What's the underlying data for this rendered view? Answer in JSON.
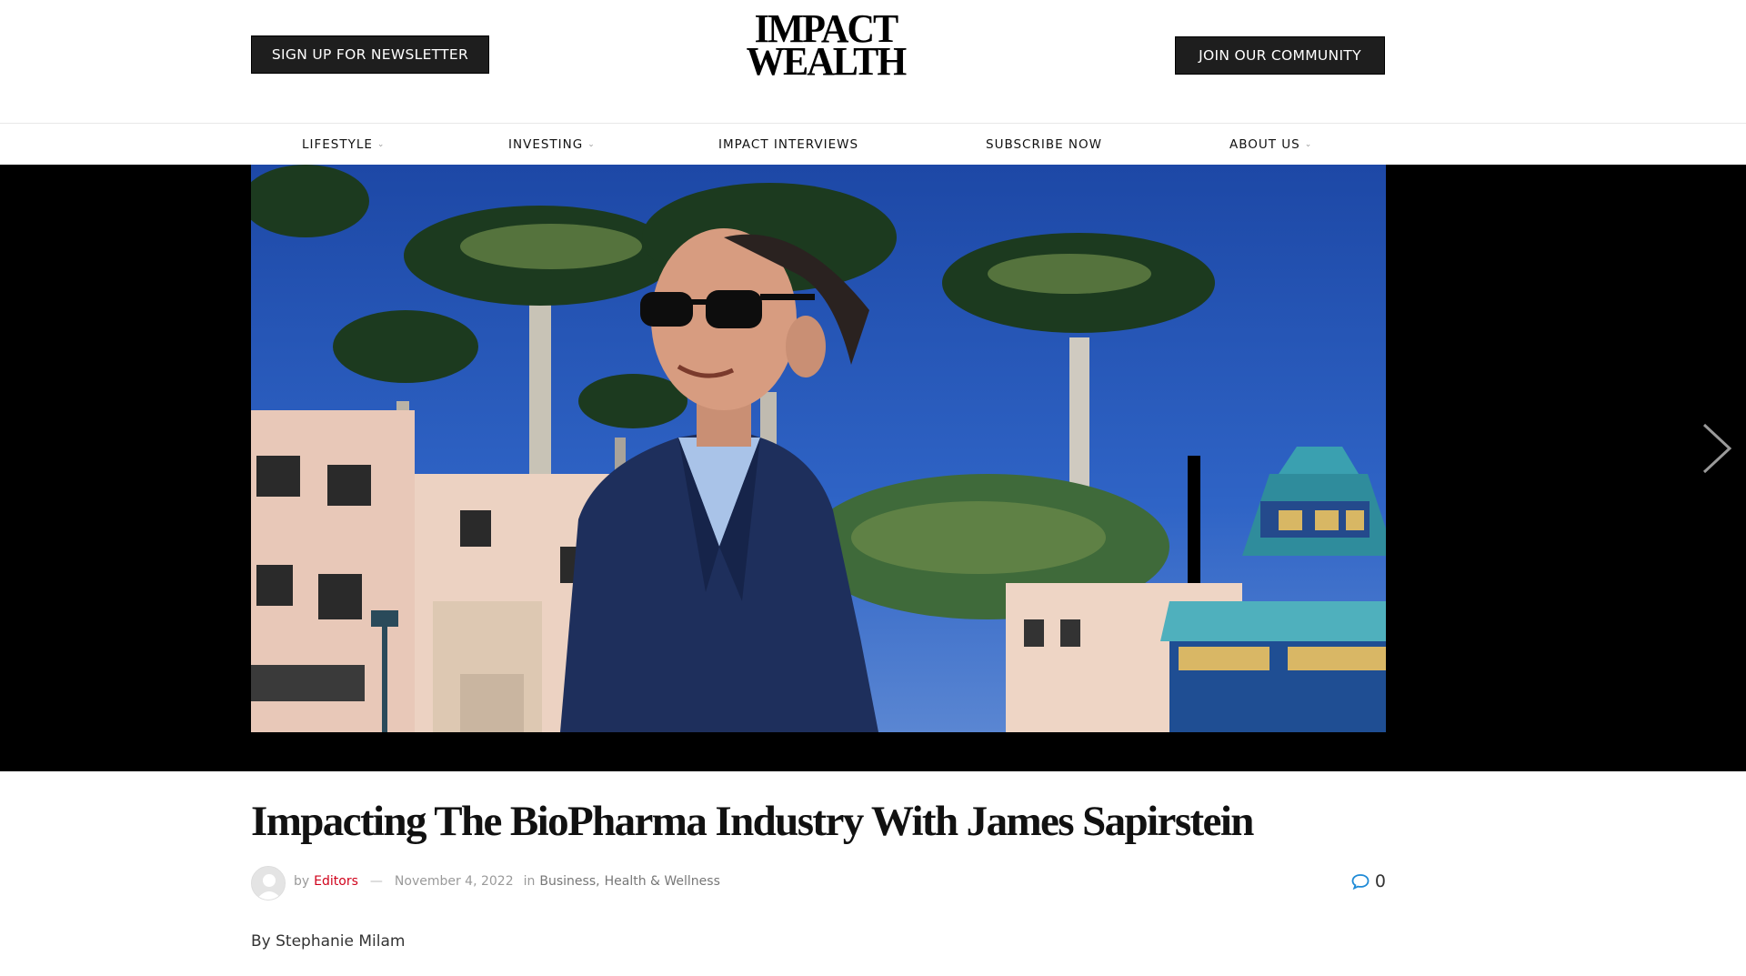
{
  "header": {
    "newsletter_label": "SIGN UP FOR NEWSLETTER",
    "logo_line1": "IMPACT",
    "logo_line2": "WEALTH",
    "community_label": "JOIN OUR COMMUNITY"
  },
  "nav": {
    "items": [
      {
        "label": "LIFESTYLE",
        "has_dropdown": true
      },
      {
        "label": "INVESTING",
        "has_dropdown": true
      },
      {
        "label": "IMPACT INTERVIEWS",
        "has_dropdown": false
      },
      {
        "label": "SUBSCRIBE NOW",
        "has_dropdown": false
      },
      {
        "label": "ABOUT US",
        "has_dropdown": true
      }
    ]
  },
  "hero": {
    "next_icon": "chevron-right-icon"
  },
  "article": {
    "title": "Impacting The BioPharma Industry With James Sapirstein",
    "meta": {
      "by": "by",
      "author": "Editors",
      "dash": "—",
      "date": "November 4, 2022",
      "in": "in",
      "categories": [
        "Business",
        "Health & Wellness"
      ],
      "category_sep": ",",
      "comment_count": "0"
    },
    "byline": "By Stephanie Milam"
  },
  "colors": {
    "accent_red": "#d0021b",
    "comment_blue": "#1e8ad6",
    "dark_button": "#1e1e1e"
  }
}
